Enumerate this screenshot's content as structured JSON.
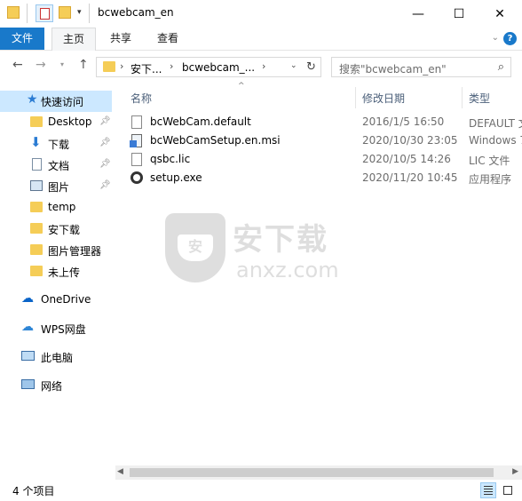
{
  "window": {
    "title": "bcwebcam_en",
    "minimize": "—",
    "maximize": "☐",
    "close": "✕"
  },
  "ribbon": {
    "tabs": [
      "文件",
      "主页",
      "共享",
      "查看"
    ],
    "expand": "⌄",
    "help": "?"
  },
  "address": {
    "crumbs": [
      "安下...",
      "bcwebcam_..."
    ],
    "search_placeholder": "搜索\"bcwebcam_en\""
  },
  "nav": {
    "items": [
      {
        "label": "快速访问",
        "icon": "star-icon",
        "pinned": false,
        "selected": true
      },
      {
        "label": "Desktop",
        "icon": "folder-icon",
        "pinned": true
      },
      {
        "label": "下载",
        "icon": "download-arrow-icon",
        "pinned": true
      },
      {
        "label": "文档",
        "icon": "document-icon",
        "pinned": true
      },
      {
        "label": "图片",
        "icon": "picture-icon",
        "pinned": true
      },
      {
        "label": "temp",
        "icon": "folder-icon",
        "pinned": false
      },
      {
        "label": "安下载",
        "icon": "folder-icon",
        "pinned": false
      },
      {
        "label": "图片管理器",
        "icon": "folder-icon",
        "pinned": false
      },
      {
        "label": "未上传",
        "icon": "folder-icon",
        "pinned": false
      },
      {
        "label": "OneDrive",
        "icon": "cloud-icon",
        "pinned": false
      },
      {
        "label": "WPS网盘",
        "icon": "wps-cloud-icon",
        "pinned": false
      },
      {
        "label": "此电脑",
        "icon": "computer-icon",
        "pinned": false
      },
      {
        "label": "网络",
        "icon": "network-icon",
        "pinned": false
      }
    ]
  },
  "columns": {
    "name": "名称",
    "date": "修改日期",
    "type": "类型"
  },
  "files": [
    {
      "name": "bcWebCam.default",
      "date": "2016/1/5 16:50",
      "type": "DEFAULT 文",
      "icon": "document-icon"
    },
    {
      "name": "bcWebCamSetup.en.msi",
      "date": "2020/10/30 23:05",
      "type": "Windows 7",
      "icon": "msi-installer-icon"
    },
    {
      "name": "qsbc.lic",
      "date": "2020/10/5 14:26",
      "type": "LIC 文件",
      "icon": "document-icon"
    },
    {
      "name": "setup.exe",
      "date": "2020/11/20 10:45",
      "type": "应用程序",
      "icon": "setup-exe-icon"
    }
  ],
  "status": {
    "count": "4 个项目"
  },
  "watermark": {
    "cn": "安下载",
    "en": "anxz.com",
    "badge": "安"
  },
  "colors": {
    "accent": "#1979ca",
    "selected_bg": "#cce8ff",
    "folder": "#f5cd57"
  }
}
